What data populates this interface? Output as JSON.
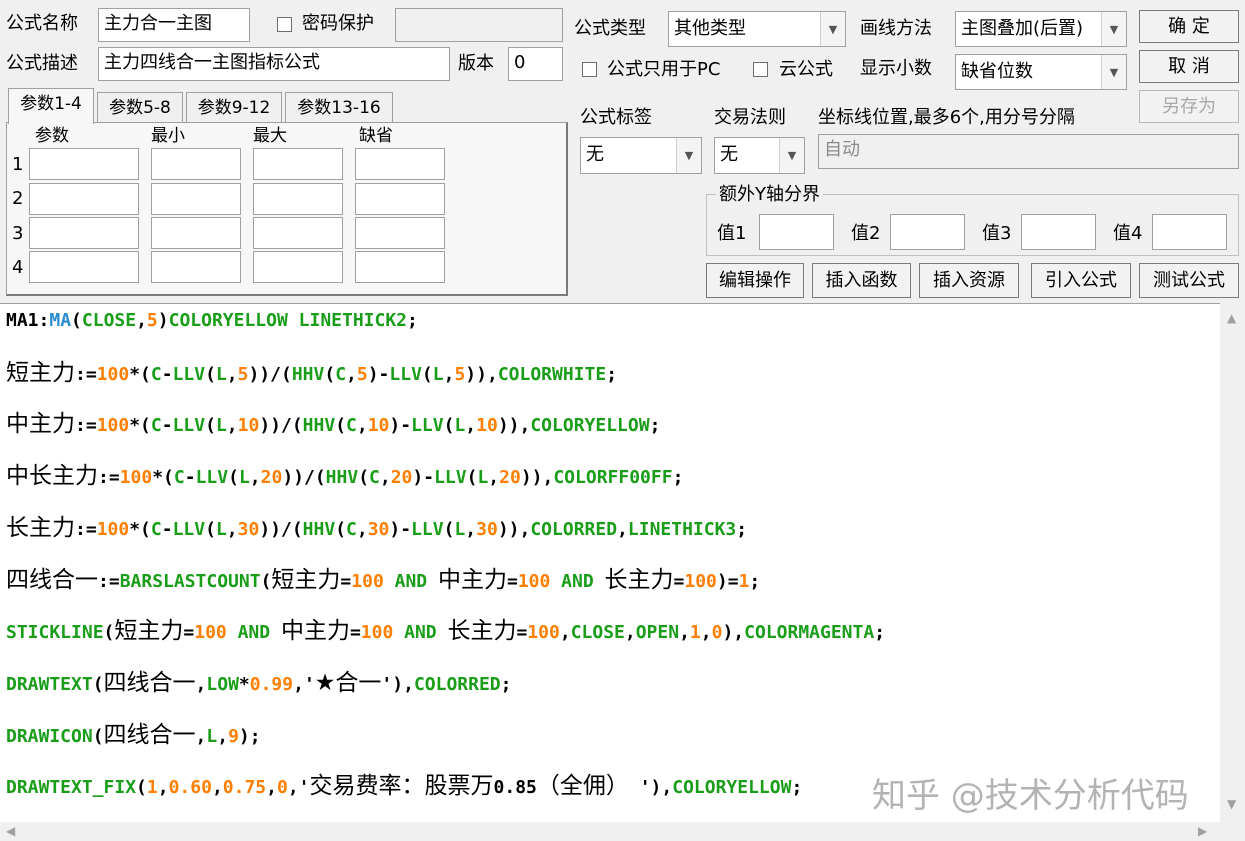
{
  "top": {
    "name_label": "公式名称",
    "name_value": "主力合一主图",
    "password_label": "密码保护",
    "password_value": "",
    "desc_label": "公式描述",
    "desc_value": "主力四线合一主图指标公式",
    "version_label": "版本",
    "version_value": "0"
  },
  "tabs": [
    "参数1-4",
    "参数5-8",
    "参数9-12",
    "参数13-16"
  ],
  "params": {
    "headers": [
      "参数",
      "最小",
      "最大",
      "缺省"
    ],
    "rows": [
      "1",
      "2",
      "3",
      "4"
    ]
  },
  "right": {
    "type_label": "公式类型",
    "type_value": "其他类型",
    "draw_label": "画线方法",
    "draw_value": "主图叠加(后置)",
    "pc_label": "公式只用于PC",
    "cloud_label": "云公式",
    "decimal_label": "显示小数",
    "decimal_value": "缺省位数",
    "tag_label": "公式标签",
    "tag_value": "无",
    "rule_label": "交易法则",
    "rule_value": "无",
    "axis_label": "坐标线位置,最多6个,用分号分隔",
    "axis_placeholder": "自动",
    "extra_y_label": "额外Y轴分界",
    "value_labels": [
      "值1",
      "值2",
      "值3",
      "值4"
    ]
  },
  "buttons": {
    "ok": "确  定",
    "cancel": "取  消",
    "save_as": "另存为",
    "edit_ops": "编辑操作",
    "insert_func": "插入函数",
    "insert_res": "插入资源",
    "import_formula": "引入公式",
    "test_formula": "测试公式"
  },
  "colors": {
    "keyword_green": "#1a9e1a",
    "number_orange": "#ff7f00",
    "func_blue": "#2a8ccc",
    "text_black": "#000000"
  },
  "code": [
    [
      [
        "MA1:",
        "k"
      ],
      [
        "MA",
        "b"
      ],
      [
        "(",
        "k"
      ],
      [
        "CLOSE",
        "g"
      ],
      [
        ",",
        "k"
      ],
      [
        "5",
        "o"
      ],
      [
        ")",
        "k"
      ],
      [
        "COLORYELLOW LINETHICK2",
        "g"
      ],
      [
        ";",
        "k"
      ]
    ],
    [
      [
        "短主力",
        "c"
      ],
      [
        ":=",
        "k"
      ],
      [
        "100",
        "o"
      ],
      [
        "*(",
        "k"
      ],
      [
        "C",
        "g"
      ],
      [
        "-",
        "k"
      ],
      [
        "LLV",
        "g"
      ],
      [
        "(",
        "k"
      ],
      [
        "L",
        "g"
      ],
      [
        ",",
        "k"
      ],
      [
        "5",
        "o"
      ],
      [
        "))/(",
        "k"
      ],
      [
        "HHV",
        "g"
      ],
      [
        "(",
        "k"
      ],
      [
        "C",
        "g"
      ],
      [
        ",",
        "k"
      ],
      [
        "5",
        "o"
      ],
      [
        ")-",
        "k"
      ],
      [
        "LLV",
        "g"
      ],
      [
        "(",
        "k"
      ],
      [
        "L",
        "g"
      ],
      [
        ",",
        "k"
      ],
      [
        "5",
        "o"
      ],
      [
        ")),",
        "k"
      ],
      [
        "COLORWHITE",
        "g"
      ],
      [
        ";",
        "k"
      ]
    ],
    [
      [
        "中主力",
        "c"
      ],
      [
        ":=",
        "k"
      ],
      [
        "100",
        "o"
      ],
      [
        "*(",
        "k"
      ],
      [
        "C",
        "g"
      ],
      [
        "-",
        "k"
      ],
      [
        "LLV",
        "g"
      ],
      [
        "(",
        "k"
      ],
      [
        "L",
        "g"
      ],
      [
        ",",
        "k"
      ],
      [
        "10",
        "o"
      ],
      [
        "))/(",
        "k"
      ],
      [
        "HHV",
        "g"
      ],
      [
        "(",
        "k"
      ],
      [
        "C",
        "g"
      ],
      [
        ",",
        "k"
      ],
      [
        "10",
        "o"
      ],
      [
        ")-",
        "k"
      ],
      [
        "LLV",
        "g"
      ],
      [
        "(",
        "k"
      ],
      [
        "L",
        "g"
      ],
      [
        ",",
        "k"
      ],
      [
        "10",
        "o"
      ],
      [
        ")),",
        "k"
      ],
      [
        "COLORYELLOW",
        "g"
      ],
      [
        ";",
        "k"
      ]
    ],
    [
      [
        "中长主力",
        "c"
      ],
      [
        ":=",
        "k"
      ],
      [
        "100",
        "o"
      ],
      [
        "*(",
        "k"
      ],
      [
        "C",
        "g"
      ],
      [
        "-",
        "k"
      ],
      [
        "LLV",
        "g"
      ],
      [
        "(",
        "k"
      ],
      [
        "L",
        "g"
      ],
      [
        ",",
        "k"
      ],
      [
        "20",
        "o"
      ],
      [
        "))/(",
        "k"
      ],
      [
        "HHV",
        "g"
      ],
      [
        "(",
        "k"
      ],
      [
        "C",
        "g"
      ],
      [
        ",",
        "k"
      ],
      [
        "20",
        "o"
      ],
      [
        ")-",
        "k"
      ],
      [
        "LLV",
        "g"
      ],
      [
        "(",
        "k"
      ],
      [
        "L",
        "g"
      ],
      [
        ",",
        "k"
      ],
      [
        "20",
        "o"
      ],
      [
        ")),",
        "k"
      ],
      [
        "COLORFF00FF",
        "g"
      ],
      [
        ";",
        "k"
      ]
    ],
    [
      [
        "长主力",
        "c"
      ],
      [
        ":=",
        "k"
      ],
      [
        "100",
        "o"
      ],
      [
        "*(",
        "k"
      ],
      [
        "C",
        "g"
      ],
      [
        "-",
        "k"
      ],
      [
        "LLV",
        "g"
      ],
      [
        "(",
        "k"
      ],
      [
        "L",
        "g"
      ],
      [
        ",",
        "k"
      ],
      [
        "30",
        "o"
      ],
      [
        "))/(",
        "k"
      ],
      [
        "HHV",
        "g"
      ],
      [
        "(",
        "k"
      ],
      [
        "C",
        "g"
      ],
      [
        ",",
        "k"
      ],
      [
        "30",
        "o"
      ],
      [
        ")-",
        "k"
      ],
      [
        "LLV",
        "g"
      ],
      [
        "(",
        "k"
      ],
      [
        "L",
        "g"
      ],
      [
        ",",
        "k"
      ],
      [
        "30",
        "o"
      ],
      [
        ")),",
        "k"
      ],
      [
        "COLORRED",
        "g"
      ],
      [
        ",",
        "k"
      ],
      [
        "LINETHICK3",
        "g"
      ],
      [
        ";",
        "k"
      ]
    ],
    [
      [
        "四线合一",
        "c"
      ],
      [
        ":=",
        "k"
      ],
      [
        "BARSLASTCOUNT",
        "g"
      ],
      [
        "(",
        "k"
      ],
      [
        "短主力",
        "c"
      ],
      [
        "=",
        "k"
      ],
      [
        "100",
        "o"
      ],
      [
        " AND ",
        "g"
      ],
      [
        "中主力",
        "c"
      ],
      [
        "=",
        "k"
      ],
      [
        "100",
        "o"
      ],
      [
        " AND ",
        "g"
      ],
      [
        "长主力",
        "c"
      ],
      [
        "=",
        "k"
      ],
      [
        "100",
        "o"
      ],
      [
        ")=",
        "k"
      ],
      [
        "1",
        "o"
      ],
      [
        ";",
        "k"
      ]
    ],
    [
      [
        "STICKLINE",
        "g"
      ],
      [
        "(",
        "k"
      ],
      [
        "短主力",
        "c"
      ],
      [
        "=",
        "k"
      ],
      [
        "100",
        "o"
      ],
      [
        " AND ",
        "g"
      ],
      [
        "中主力",
        "c"
      ],
      [
        "=",
        "k"
      ],
      [
        "100",
        "o"
      ],
      [
        " AND ",
        "g"
      ],
      [
        "长主力",
        "c"
      ],
      [
        "=",
        "k"
      ],
      [
        "100",
        "o"
      ],
      [
        ",",
        "k"
      ],
      [
        "CLOSE",
        "g"
      ],
      [
        ",",
        "k"
      ],
      [
        "OPEN",
        "g"
      ],
      [
        ",",
        "k"
      ],
      [
        "1",
        "o"
      ],
      [
        ",",
        "k"
      ],
      [
        "0",
        "o"
      ],
      [
        "),",
        "k"
      ],
      [
        "COLORMAGENTA",
        "g"
      ],
      [
        ";",
        "k"
      ]
    ],
    [
      [
        "DRAWTEXT",
        "g"
      ],
      [
        "(",
        "k"
      ],
      [
        "四线合一",
        "c"
      ],
      [
        ",",
        "k"
      ],
      [
        "LOW",
        "g"
      ],
      [
        "*",
        "k"
      ],
      [
        "0.99",
        "o"
      ],
      [
        ",'",
        "k"
      ],
      [
        "★合一",
        "c"
      ],
      [
        "'),",
        "k"
      ],
      [
        "COLORRED",
        "g"
      ],
      [
        ";",
        "k"
      ]
    ],
    [
      [
        "DRAWICON",
        "g"
      ],
      [
        "(",
        "k"
      ],
      [
        "四线合一",
        "c"
      ],
      [
        ",",
        "k"
      ],
      [
        "L",
        "g"
      ],
      [
        ",",
        "k"
      ],
      [
        "9",
        "o"
      ],
      [
        ");",
        "k"
      ]
    ],
    [
      [
        "DRAWTEXT_FIX",
        "g"
      ],
      [
        "(",
        "k"
      ],
      [
        "1",
        "o"
      ],
      [
        ",",
        "k"
      ],
      [
        "0.60",
        "o"
      ],
      [
        ",",
        "k"
      ],
      [
        "0.75",
        "o"
      ],
      [
        ",",
        "k"
      ],
      [
        "0",
        "o"
      ],
      [
        ",'",
        "k"
      ],
      [
        "交易费率：股票万",
        "c"
      ],
      [
        "0.85",
        "k"
      ],
      [
        "（全佣）",
        "c"
      ],
      [
        " '),",
        "k"
      ],
      [
        "COLORYELLOW",
        "g"
      ],
      [
        ";",
        "k"
      ]
    ]
  ],
  "watermark": "知乎 @技术分析代码"
}
